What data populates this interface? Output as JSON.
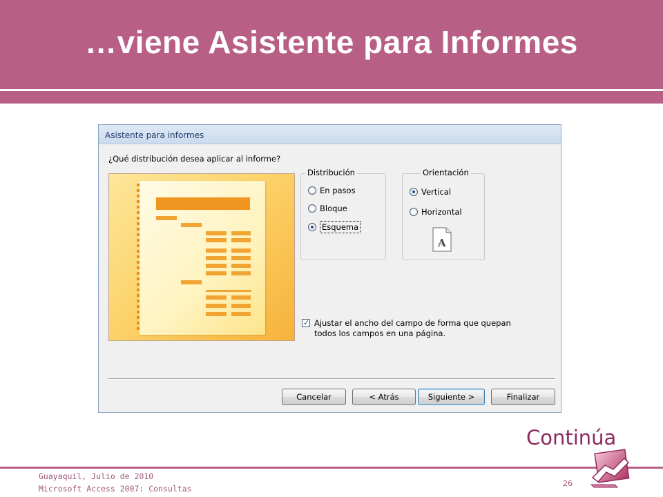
{
  "slide": {
    "title": "…viene Asistente para Informes",
    "continue_label": "Continúa",
    "footer_line1": "Guayaquil, Julio de 2010",
    "footer_line2": "Microsoft Access 2007: Consultas",
    "page_number": "26"
  },
  "dialog": {
    "title": "Asistente para informes",
    "question": "¿Qué distribución desea aplicar al informe?",
    "distribution": {
      "legend": "Distribución",
      "options": [
        "En pasos",
        "Bloque",
        "Esquema"
      ],
      "selected": "Esquema"
    },
    "orientation": {
      "legend": "Orientación",
      "options": [
        "Vertical",
        "Horizontal"
      ],
      "selected": "Vertical",
      "page_icon_letter": "A"
    },
    "adjust_checkbox": {
      "label": "Ajustar el ancho del campo de forma que quepan todos los campos en una página.",
      "checked": true
    },
    "buttons": {
      "cancel": "Cancelar",
      "back": "< Atrás",
      "next": "Siguiente >",
      "finish": "Finalizar"
    }
  },
  "colors": {
    "header": "#b85f85",
    "accent_text": "#8e2b5f"
  }
}
